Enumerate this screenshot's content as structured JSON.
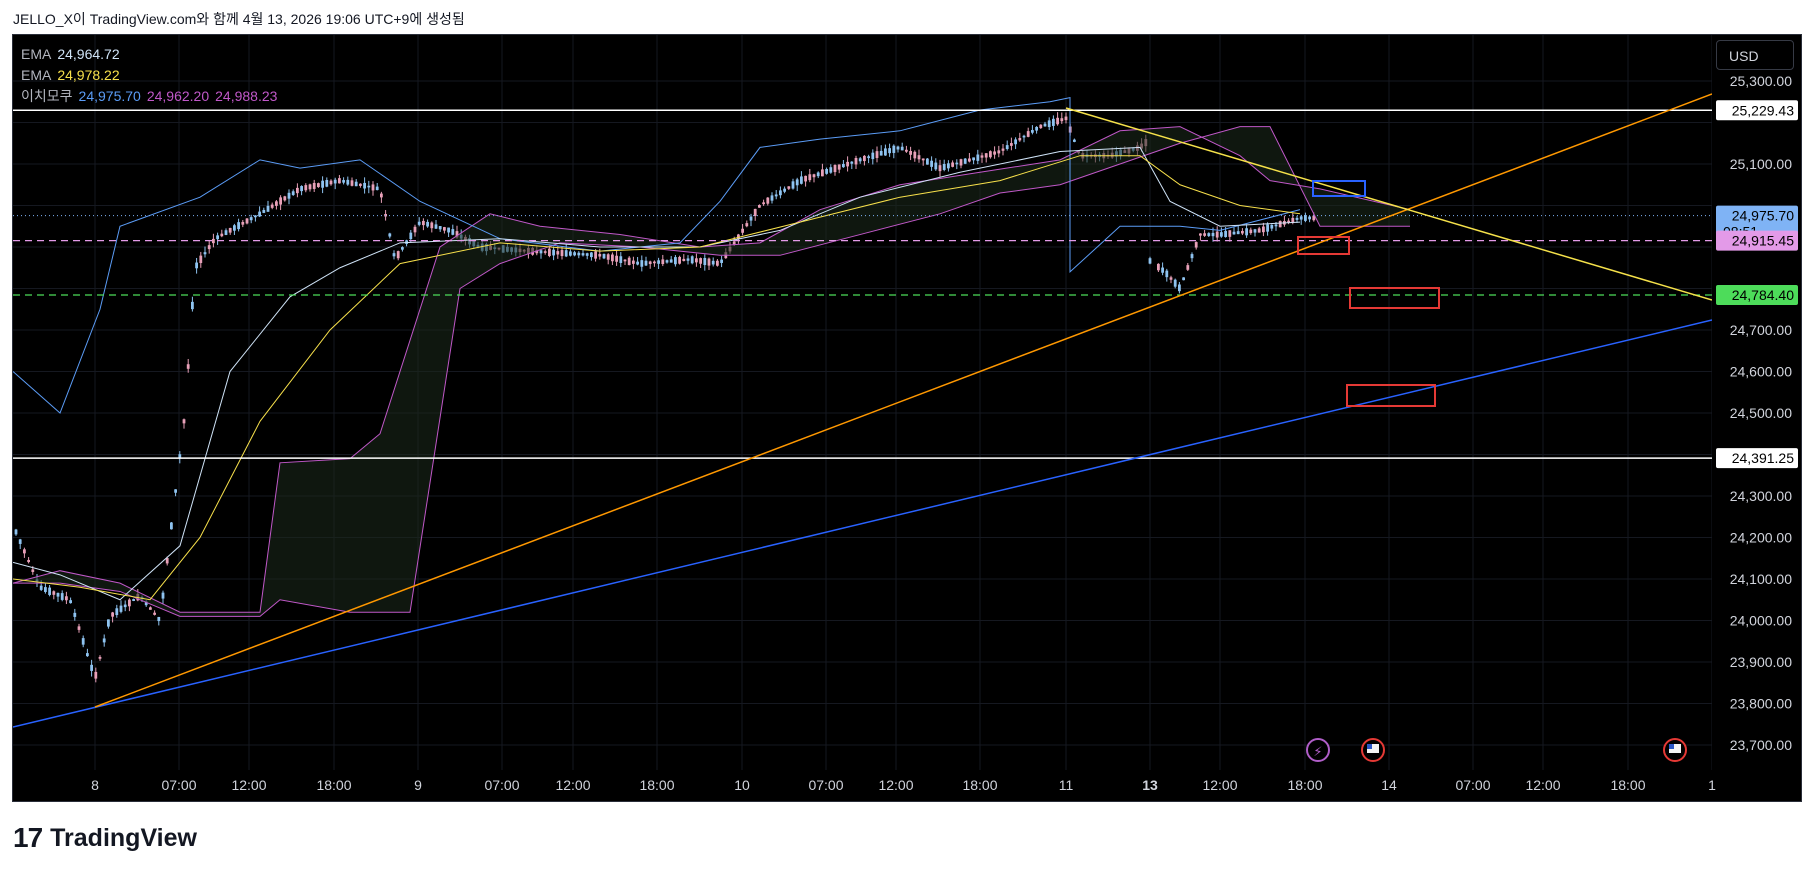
{
  "header": {
    "text": "JELLO_X이 TradingView.com와 함께 4월 13, 2026 19:06 UTC+9에 생성됨"
  },
  "legend": [
    {
      "name": "EMA",
      "values": [
        "24,964.72"
      ],
      "colors": [
        "#cfe3f7"
      ]
    },
    {
      "name": "EMA",
      "values": [
        "24,978.22"
      ],
      "colors": [
        "#f7e04b"
      ]
    },
    {
      "name": "이치모쿠",
      "values": [
        "24,975.70",
        "24,962.20",
        "24,988.23"
      ],
      "colors": [
        "#5b9cf6",
        "#c058c8",
        "#c058c8"
      ]
    }
  ],
  "currency_button": "USD",
  "footer": {
    "logo": "17",
    "brand": "TradingView"
  },
  "chart_data": {
    "type": "candlestick",
    "ylim": [
      23600,
      25400
    ],
    "y_ticks": [
      23700,
      23800,
      23900,
      24000,
      24100,
      24200,
      24300,
      24400,
      24500,
      24600,
      24700,
      24800,
      24900,
      25000,
      25100,
      25200,
      25300
    ],
    "y_tick_labels": [
      "23,700.00",
      "23,800.00",
      "23,900.00",
      "24,000.00",
      "24,100.00",
      "24,200.00",
      "24,300.00",
      "",
      "24,500.00",
      "24,600.00",
      "24,700.00",
      "",
      "",
      "",
      "25,100.00",
      "",
      "25,300.00"
    ],
    "x_ticks": [
      "8",
      "07:00",
      "12:00",
      "18:00",
      "9",
      "07:00",
      "12:00",
      "18:00",
      "10",
      "07:00",
      "12:00",
      "18:00",
      "11",
      "13",
      "12:00",
      "18:00",
      "14",
      "07:00",
      "12:00",
      "18:00",
      "1"
    ],
    "x_tick_bold": [
      false,
      false,
      false,
      false,
      false,
      false,
      false,
      false,
      false,
      false,
      false,
      false,
      false,
      true,
      false,
      false,
      false,
      false,
      false,
      false,
      false
    ],
    "price_labels": [
      {
        "value": "25,229.43",
        "price": 25229.43,
        "bg": "#ffffff",
        "fg": "#000000"
      },
      {
        "value": "24,975.70",
        "sub": "08:51",
        "price": 24975.7,
        "bg": "#7fb3f5",
        "fg": "#000000"
      },
      {
        "value": "24,915.45",
        "price": 24915.45,
        "bg": "#e39ae8",
        "fg": "#000000"
      },
      {
        "value": "24,784.40",
        "price": 24784.4,
        "bg": "#4ddc5a",
        "fg": "#000000"
      },
      {
        "value": "24,391.25",
        "price": 24391.25,
        "bg": "#ffffff",
        "fg": "#000000"
      }
    ],
    "horizontal_lines": [
      {
        "price": 25229.43,
        "color": "#ffffff",
        "style": "solid"
      },
      {
        "price": 24391.25,
        "color": "#ffffff",
        "style": "solid"
      },
      {
        "price": 24915.45,
        "color": "#e39ae8",
        "style": "dashed"
      },
      {
        "price": 24784.4,
        "color": "#4ddc5a",
        "style": "dashed"
      }
    ],
    "colors": {
      "up": "#e8a0b8",
      "down": "#8ec3f0",
      "orange": "#ff9800",
      "yellow": "#f5e14a",
      "blue": "#2962ff",
      "red": "#e53935",
      "box_blue": "#2962ff"
    }
  }
}
